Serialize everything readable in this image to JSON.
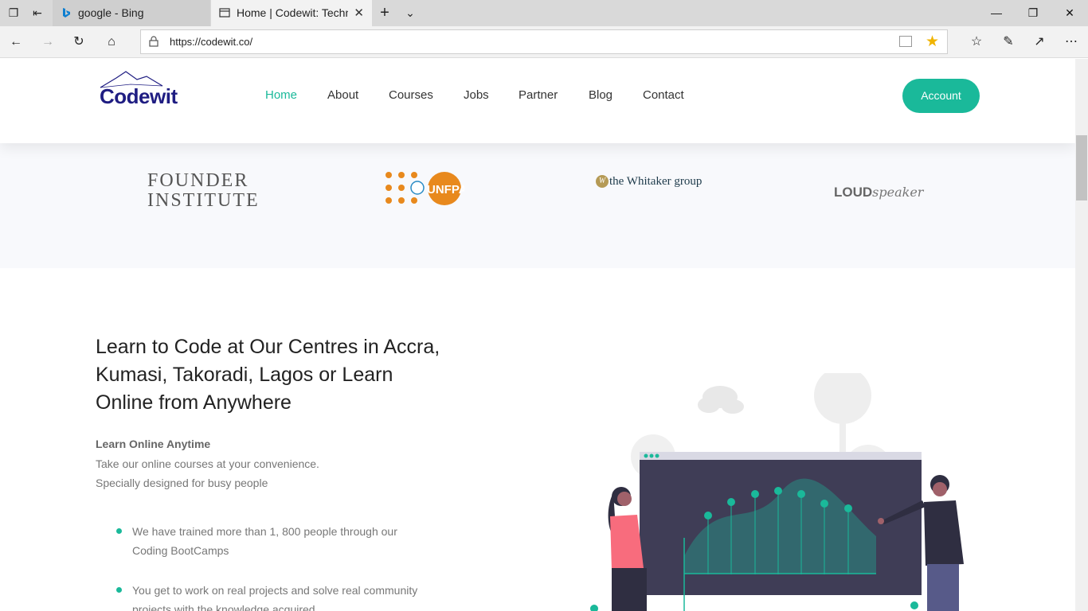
{
  "browser": {
    "tabs": [
      {
        "title": "google - Bing",
        "active": false
      },
      {
        "title": "Home | Codewit: Technology",
        "active": true
      }
    ],
    "url": "https://codewit.co/"
  },
  "site": {
    "logo_text": "Codewit",
    "nav": [
      "Home",
      "About",
      "Courses",
      "Jobs",
      "Partner",
      "Blog",
      "Contact"
    ],
    "active_nav": "Home",
    "account_label": "Account",
    "accent_color": "#1ab99a",
    "brand_color": "#1f1d82"
  },
  "partners": {
    "founder_line1": "Founder",
    "founder_line2": "Institute",
    "unfpa": "UNFPA",
    "whitaker": "the Whitaker group",
    "whitaker_mark": "W",
    "loud": "LOUD",
    "speaker": "speaker"
  },
  "hero": {
    "headline_line1": "Learn to Code at Our Centres in Accra,",
    "headline_line2": "Kumasi, Takoradi, Lagos or Learn",
    "headline_line3": "Online from Anywhere",
    "sub_title": "Learn Online Anytime",
    "sub_line1": "Take our online courses at your convenience.",
    "sub_line2": "Specially designed for busy people",
    "bullets": [
      {
        "line1": "We have trained more than 1, 800 people through our",
        "line2": "Coding BootCamps"
      },
      {
        "line1": "You get to work on real projects and solve real community",
        "line2": "projects with the knowledge acquired"
      }
    ]
  }
}
